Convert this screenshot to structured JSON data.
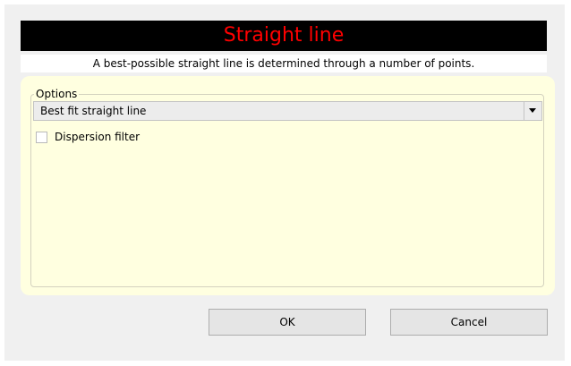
{
  "dialog": {
    "title": "Straight line",
    "description": "A best-possible straight line is determined through a number of points.",
    "colors": {
      "title_background": "#000000",
      "title_text": "#ff0000",
      "panel_background": "#ffffe0"
    }
  },
  "options": {
    "group_label": "Options",
    "method_select": {
      "selected": "Best fit straight line"
    },
    "dispersion_filter": {
      "label": "Dispersion filter",
      "checked": false
    }
  },
  "buttons": {
    "ok_label": "OK",
    "cancel_label": "Cancel"
  }
}
